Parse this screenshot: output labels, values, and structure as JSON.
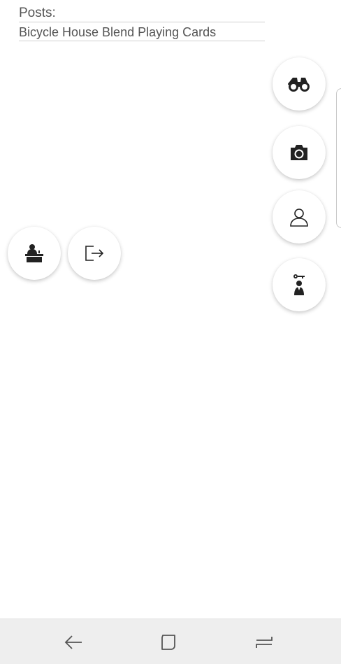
{
  "header": {
    "posts_label": "Posts:"
  },
  "posts": [
    {
      "title": "Bicycle House Blend Playing Cards"
    }
  ],
  "fabs_right": [
    {
      "icon": "binoculars-icon"
    },
    {
      "icon": "camera-icon"
    },
    {
      "icon": "user-icon"
    },
    {
      "icon": "person-key-icon"
    }
  ],
  "fabs_left": [
    {
      "icon": "desk-person-icon"
    },
    {
      "icon": "logout-icon"
    }
  ],
  "navbar": {
    "back_icon": "back-arrow-icon",
    "home_icon": "home-square-icon",
    "recents_icon": "recents-icon"
  },
  "colors": {
    "icon": "#222222",
    "text": "#555555",
    "navbar_bg": "#eeeeee"
  }
}
